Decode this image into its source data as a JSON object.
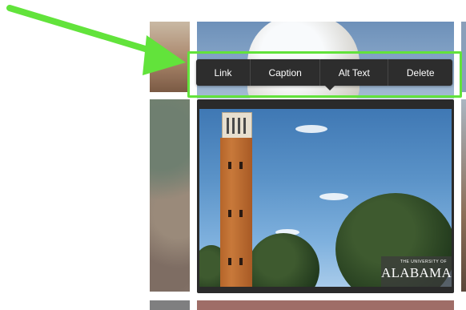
{
  "toolbar": {
    "buttons": [
      {
        "label": "Link"
      },
      {
        "label": "Caption"
      },
      {
        "label": "Alt Text"
      },
      {
        "label": "Delete"
      }
    ]
  },
  "selected_image": {
    "watermark_line1": "THE UNIVERSITY OF",
    "watermark_line2": "ALABAMA"
  },
  "annotation": {
    "arrow_icon": "green-pointer-arrow-icon",
    "highlight_color": "#62e33b"
  },
  "colors": {
    "toolbar_background": "#2d2d2d",
    "toolbar_text": "#ffffff",
    "highlight": "#62e33b"
  }
}
